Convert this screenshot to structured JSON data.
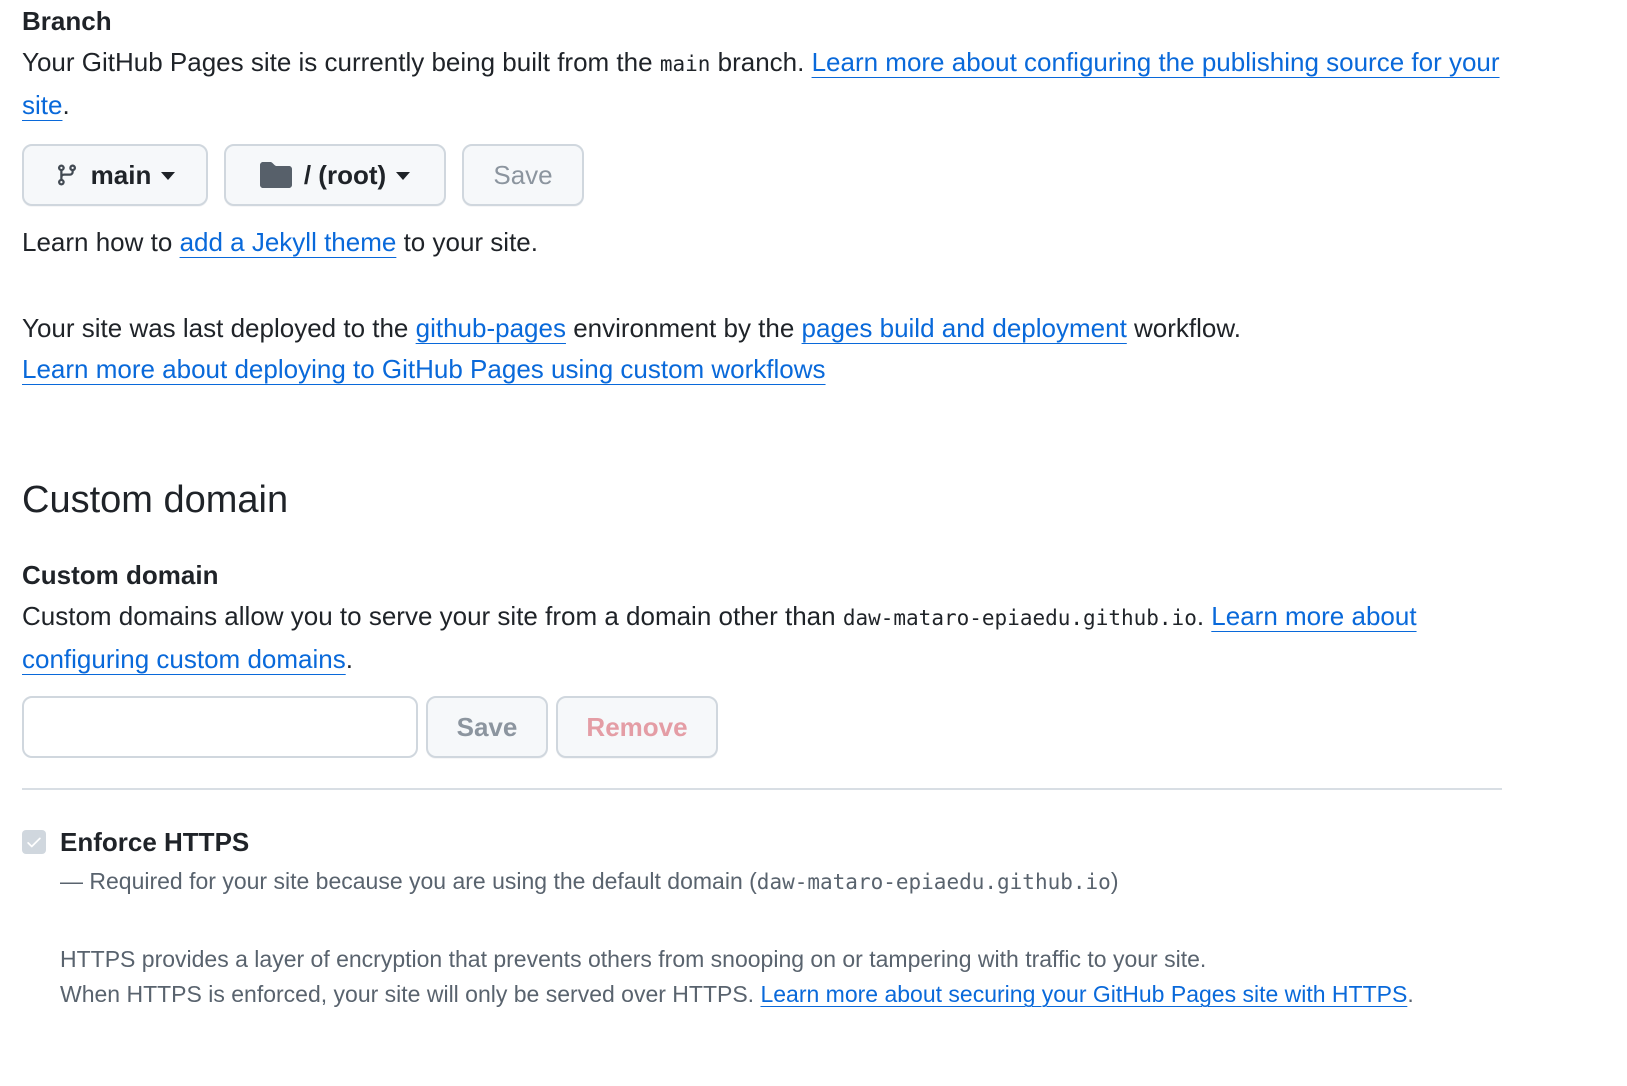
{
  "branch": {
    "label": "Branch",
    "desc_prefix": "Your GitHub Pages site is currently being built from the ",
    "branch_code": "main",
    "desc_suffix": " branch. ",
    "learn_link_1": "Learn more about configuring the publishing source for your site",
    "desc_end": ".",
    "branch_button_label": "main",
    "folder_button_label": "/ (root)",
    "save_button_label": "Save",
    "jekyll_prefix": "Learn how to ",
    "jekyll_link": "add a Jekyll theme",
    "jekyll_suffix": " to your site."
  },
  "deploy": {
    "prefix": "Your site was last deployed to the ",
    "env_link": "github-pages",
    "middle": " environment by the ",
    "workflow_link": "pages build and deployment",
    "suffix": " workflow.",
    "custom_workflows_link": "Learn more about deploying to GitHub Pages using custom workflows"
  },
  "custom_domain": {
    "section_title": "Custom domain",
    "label": "Custom domain",
    "desc_prefix": "Custom domains allow you to serve your site from a domain other than ",
    "default_domain": "daw-mataro-epiaedu.github.io",
    "desc_sep": ". ",
    "learn_link": "Learn more about configuring custom domains",
    "desc_end": ".",
    "input_value": "",
    "input_placeholder": "",
    "save_button_label": "Save",
    "remove_button_label": "Remove"
  },
  "https": {
    "checkbox_label": "Enforce HTTPS",
    "checked": true,
    "required_prefix": "— Required for your site because you are using the default domain (",
    "required_domain": "daw-mataro-epiaedu.github.io",
    "required_suffix": ")",
    "info_line_1": "HTTPS provides a layer of encryption that prevents others from snooping on or tampering with traffic to your site.",
    "info_line_2_prefix": "When HTTPS is enforced, your site will only be served over HTTPS. ",
    "info_link": "Learn more about securing your GitHub Pages site with HTTPS",
    "info_end": "."
  },
  "colors": {
    "link": "#0969da",
    "text": "#1f2328",
    "muted": "#59636e",
    "border": "#d0d7de",
    "button_bg": "#f6f8fa",
    "danger_disabled": "#e49da5"
  }
}
